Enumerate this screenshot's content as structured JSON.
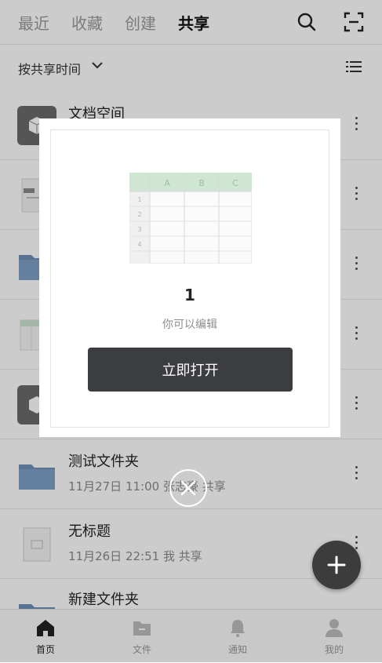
{
  "header": {
    "tabs": [
      {
        "label": "最近",
        "active": false
      },
      {
        "label": "收藏",
        "active": false
      },
      {
        "label": "创建",
        "active": false
      },
      {
        "label": "共享",
        "active": true
      }
    ],
    "icons": [
      "search-icon",
      "scan-icon"
    ]
  },
  "sortbar": {
    "label": "按共享时间",
    "icon": "chevron-down-icon",
    "view_icon": "list-view-icon"
  },
  "list": [
    {
      "title": "文档空间",
      "meta": "",
      "type": "space"
    },
    {
      "title": "",
      "meta": "",
      "type": "doc"
    },
    {
      "title": "",
      "meta": "",
      "type": "folder"
    },
    {
      "title": "",
      "meta": "",
      "type": "sheet"
    },
    {
      "title": "",
      "meta": "",
      "type": "space"
    },
    {
      "title": "测试文件夹",
      "meta": "11月27日 11:00 张志豪 共享",
      "type": "folder"
    },
    {
      "title": "无标题",
      "meta": "11月26日 22:51 我 共享",
      "type": "doc"
    },
    {
      "title": "新建文件夹",
      "meta": "",
      "type": "folder"
    }
  ],
  "modal": {
    "preview_columns": [
      "A",
      "B",
      "C"
    ],
    "preview_rows": [
      "1",
      "2",
      "3",
      "4"
    ],
    "title": "1",
    "subtitle": "你可以编辑",
    "button_label": "立即打开"
  },
  "bottom_nav": [
    {
      "label": "首页",
      "icon": "home-icon",
      "active": true
    },
    {
      "label": "文件",
      "icon": "folder-icon",
      "active": false
    },
    {
      "label": "通知",
      "icon": "bell-icon",
      "active": false
    },
    {
      "label": "我的",
      "icon": "user-icon",
      "active": false
    }
  ],
  "colors": {
    "accent_dark": "#3b3d40",
    "folder": "#6f8fb6",
    "sheet_header": "#cfe6d3"
  }
}
